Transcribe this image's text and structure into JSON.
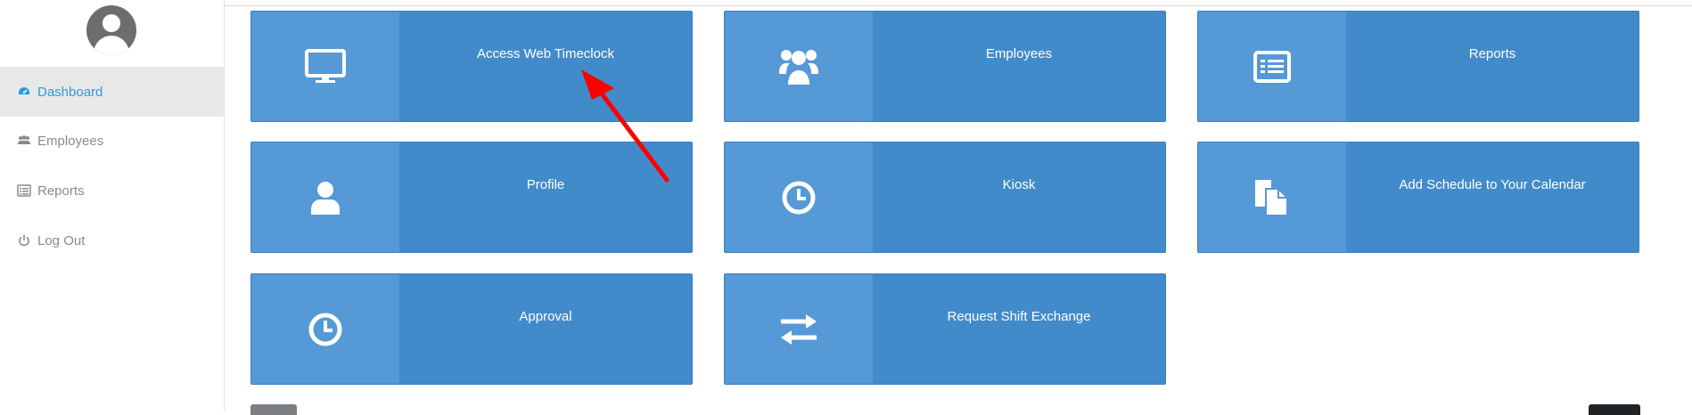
{
  "sidebar": {
    "items": [
      {
        "label": "Dashboard",
        "icon": "dashboard-icon",
        "active": true
      },
      {
        "label": "Employees",
        "icon": "users-icon",
        "active": false
      },
      {
        "label": "Reports",
        "icon": "list-icon",
        "active": false
      },
      {
        "label": "Log Out",
        "icon": "power-icon",
        "active": false
      }
    ]
  },
  "tiles": [
    {
      "label": "Access Web Timeclock",
      "icon": "monitor-icon"
    },
    {
      "label": "Employees",
      "icon": "users-group-icon"
    },
    {
      "label": "Reports",
      "icon": "list-icon"
    },
    {
      "label": "Profile",
      "icon": "user-icon"
    },
    {
      "label": "Kiosk",
      "icon": "clock-icon"
    },
    {
      "label": "Add Schedule to Your Calendar",
      "icon": "document-icon"
    },
    {
      "label": "Approval",
      "icon": "clock-icon"
    },
    {
      "label": "Request Shift Exchange",
      "icon": "exchange-icon"
    }
  ],
  "colors": {
    "tile": "#428bca",
    "tile_icon_panel": "#5599d6",
    "active_nav_text": "#2b9be0",
    "annotation_arrow": "#ff0000"
  }
}
